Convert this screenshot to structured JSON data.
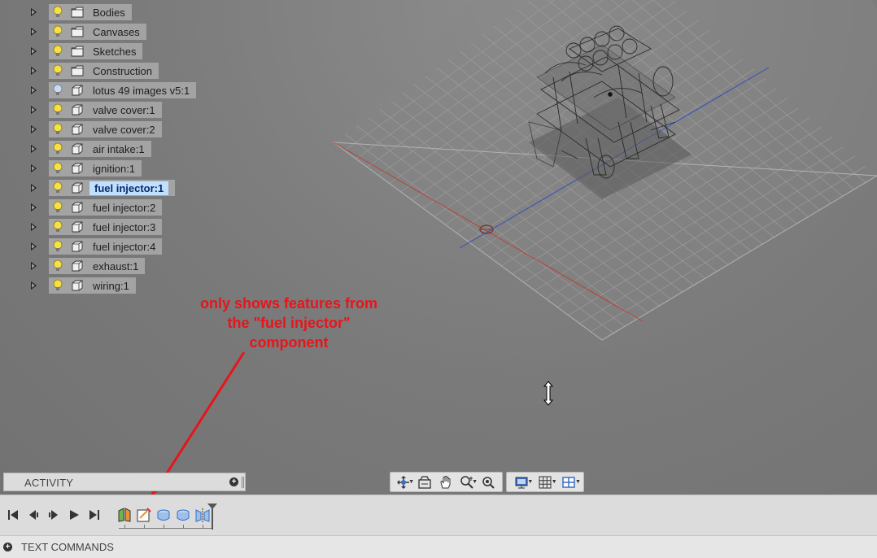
{
  "browser": {
    "items": [
      {
        "label": "Bodies",
        "type": "folder",
        "bulb": "on"
      },
      {
        "label": "Canvases",
        "type": "folder",
        "bulb": "on"
      },
      {
        "label": "Sketches",
        "type": "folder",
        "bulb": "on"
      },
      {
        "label": "Construction",
        "type": "folder",
        "bulb": "on"
      },
      {
        "label": "lotus 49 images v5:1",
        "type": "component",
        "bulb": "off"
      },
      {
        "label": "valve cover:1",
        "type": "component",
        "bulb": "on"
      },
      {
        "label": "valve cover:2",
        "type": "component",
        "bulb": "on"
      },
      {
        "label": "air intake:1",
        "type": "component",
        "bulb": "on"
      },
      {
        "label": "ignition:1",
        "type": "component",
        "bulb": "on"
      },
      {
        "label": "fuel injector:1",
        "type": "component",
        "bulb": "on",
        "selected": true
      },
      {
        "label": "fuel injector:2",
        "type": "component",
        "bulb": "on"
      },
      {
        "label": "fuel injector:3",
        "type": "component",
        "bulb": "on"
      },
      {
        "label": "fuel injector:4",
        "type": "component",
        "bulb": "on"
      },
      {
        "label": "exhaust:1",
        "type": "component",
        "bulb": "on"
      },
      {
        "label": "wiring:1",
        "type": "component",
        "bulb": "on"
      }
    ]
  },
  "annotation": {
    "text": "only shows features from\nthe \"fuel injector\"\ncomponent",
    "color": "#e8141b"
  },
  "activity": {
    "label": "ACTIVITY"
  },
  "navbar": {
    "tools": [
      "orbit-icon",
      "look-at-icon",
      "pan-icon",
      "zoom-icon",
      "fit-icon"
    ],
    "display": [
      "display-settings-icon",
      "grid-icon",
      "viewports-icon"
    ]
  },
  "timeline": {
    "controls": [
      "go-to-start-icon",
      "step-back-icon",
      "play-icon",
      "step-forward-icon",
      "go-to-end-icon"
    ],
    "features": [
      "split-body-icon",
      "sketch-feature-icon",
      "extrude-icon",
      "revolve-icon",
      "mirror-icon"
    ]
  },
  "text_commands": {
    "label": "TEXT COMMANDS"
  },
  "colors": {
    "accent_selected_bg": "#bfe0ff",
    "selected_text": "#0a2a66",
    "annotation": "#e8141b",
    "x_axis": "#c0392b",
    "z_axis": "#2346c8"
  }
}
